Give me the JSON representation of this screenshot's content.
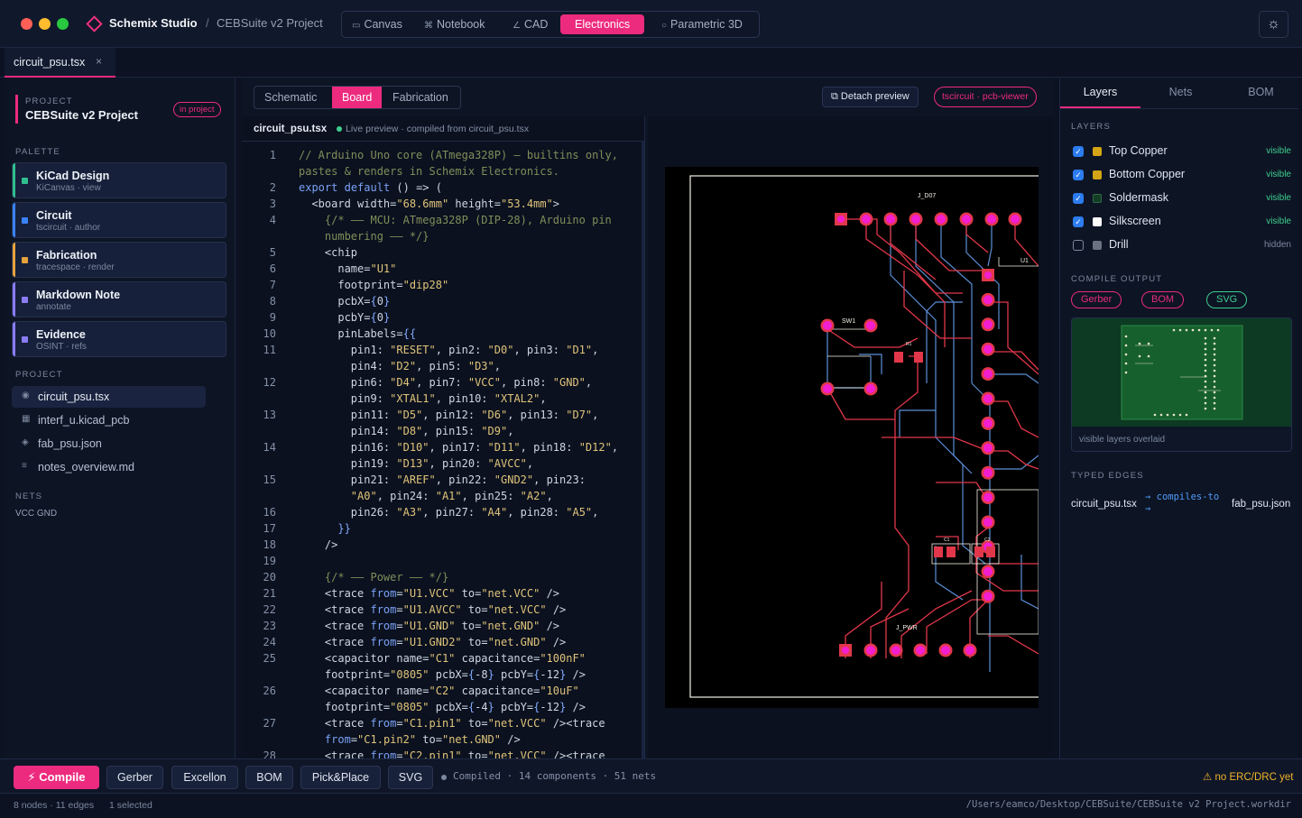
{
  "window": {
    "app_name": "Schemix Studio",
    "crumb_separator": "/",
    "project_crumb": "CEBSuite v2 Project",
    "modes": [
      {
        "icon": "▭",
        "label": "Canvas"
      },
      {
        "icon": "⌘",
        "label": "Notebook"
      },
      {
        "icon": "∠",
        "label": "CAD"
      },
      {
        "icon": "",
        "label": "Electronics",
        "active": true
      },
      {
        "icon": "○",
        "label": "Parametric 3D"
      }
    ],
    "theme_icon": "☼",
    "colors": {
      "accent": "#ec2b7e",
      "background": "#0c1222",
      "panel": "#0d1424",
      "ok": "#3ecf8e",
      "warn": "#f0b429"
    }
  },
  "tabbar": {
    "file_tab": "circuit_psu.tsx",
    "close_glyph": "×"
  },
  "sidebar": {
    "project_label": "PROJECT",
    "project_name": "CEBSuite v2 Project",
    "in_project_badge": "in project",
    "palette_label": "PALETTE",
    "palette": [
      {
        "title": "KiCad Design",
        "subtitle": "KiCanvas · view",
        "color": "#2fbf8f"
      },
      {
        "title": "Circuit",
        "subtitle": "tscircuit · author",
        "color": "#3b82f6"
      },
      {
        "title": "Fabrication",
        "subtitle": "tracespace · render",
        "color": "#e6a23c"
      },
      {
        "title": "Markdown Note",
        "subtitle": "annotate",
        "color": "#8b7cf6"
      },
      {
        "title": "Evidence",
        "subtitle": "OSINT · refs",
        "color": "#8b7cf6"
      }
    ],
    "files_label": "PROJECT",
    "files": [
      {
        "icon": "◉",
        "name": "circuit_psu.tsx",
        "selected": true
      },
      {
        "icon": "▦",
        "name": "interf_u.kicad_pcb"
      },
      {
        "icon": "◈",
        "name": "fab_psu.json"
      },
      {
        "icon": "≡",
        "name": "notes_overview.md"
      }
    ],
    "nets_label": "NETS",
    "nets_value": "VCC GND"
  },
  "center": {
    "subtabs": [
      "Schematic",
      "Board",
      "Fabrication"
    ],
    "active_subtab": "Board",
    "detach_label": "⧉ Detach preview",
    "viewer_badge": "tscircuit · pcb-viewer",
    "editor_file": "circuit_psu.tsx",
    "live_text": "Live preview · compiled from circuit_psu.tsx",
    "line_numbers": [
      "1",
      "2",
      "3",
      "4",
      "5",
      "6",
      "7",
      "8",
      "9",
      "10",
      "11",
      "12",
      "13",
      "14",
      "15",
      "16",
      "17",
      "18",
      "19",
      "20",
      "21",
      "22",
      "23",
      "24",
      "25",
      "26",
      "27",
      "28"
    ],
    "code_lines": [
      "// Arduino Uno core (ATmega328P) — builtins only,",
      "pastes & renders in Schemix Electronics.",
      "export default () => (",
      "  <board width=\"68.6mm\" height=\"53.4mm\">",
      "    {/* —— MCU: ATmega328P (DIP-28), Arduino pin",
      "    numbering —— */}",
      "    <chip",
      "      name=\"U1\"",
      "      footprint=\"dip28\"",
      "      pcbX={0}",
      "      pcbY={0}",
      "      pinLabels={{",
      "        pin1: \"RESET\", pin2: \"D0\", pin3: \"D1\",",
      "        pin4: \"D2\", pin5: \"D3\",",
      "        pin6: \"D4\", pin7: \"VCC\", pin8: \"GND\",",
      "        pin9: \"XTAL1\", pin10: \"XTAL2\",",
      "        pin11: \"D5\", pin12: \"D6\", pin13: \"D7\",",
      "        pin14: \"D8\", pin15: \"D9\",",
      "        pin16: \"D10\", pin17: \"D11\", pin18: \"D12\",",
      "        pin19: \"D13\", pin20: \"AVCC\",",
      "        pin21: \"AREF\", pin22: \"GND2\", pin23:",
      "        \"A0\", pin24: \"A1\", pin25: \"A2\",",
      "        pin26: \"A3\", pin27: \"A4\", pin28: \"A5\",",
      "      }}",
      "    />",
      "",
      "    {/* —— Power —— */}",
      "    <trace from=\"U1.VCC\" to=\"net.VCC\" />",
      "    <trace from=\"U1.AVCC\" to=\"net.VCC\" />",
      "    <trace from=\"U1.GND\" to=\"net.GND\" />",
      "    <trace from=\"U1.GND2\" to=\"net.GND\" />",
      "    <capacitor name=\"C1\" capacitance=\"100nF\"",
      "    footprint=\"0805\" pcbX={-8} pcbY={-12} />",
      "    <capacitor name=\"C2\" capacitance=\"10uF\"",
      "    footprint=\"0805\" pcbX={-4} pcbY={-12} />",
      "    <trace from=\"C1.pin1\" to=\"net.VCC\" /><trace",
      "    from=\"C1.pin2\" to=\"net.GND\" />",
      "    <trace from=\"C2.pin1\" to=\"net.VCC\" /><trace"
    ],
    "pcb_labels": {
      "top_header": "J_D07",
      "chip": "U1",
      "switch": "SW1",
      "resistor": "R1",
      "cap1": "C1",
      "cap2": "C2",
      "power": "J_PWR"
    }
  },
  "right": {
    "tabs": [
      "Layers",
      "Nets",
      "BOM"
    ],
    "active_tab": "Layers",
    "layers_title": "LAYERS",
    "layers": [
      {
        "name": "Top Copper",
        "state": "visible",
        "checked": true,
        "color": "#d4a514"
      },
      {
        "name": "Bottom Copper",
        "state": "visible",
        "checked": true,
        "color": "#d4a514"
      },
      {
        "name": "Soldermask",
        "state": "visible",
        "checked": true,
        "color": "#153d26"
      },
      {
        "name": "Silkscreen",
        "state": "visible",
        "checked": true,
        "color": "#ffffff"
      },
      {
        "name": "Drill",
        "state": "hidden",
        "checked": false,
        "color": "#6b7280"
      }
    ],
    "compile_title": "COMPILE OUTPUT",
    "outputs": [
      {
        "label": "Gerber",
        "color": "#ec2b7e"
      },
      {
        "label": "BOM",
        "color": "#ec2b7e"
      },
      {
        "label": "SVG",
        "color": "#3ecf8e"
      }
    ],
    "thumb_caption": "visible layers overlaid",
    "edges_title": "TYPED EDGES",
    "edge": {
      "from": "circuit_psu.tsx",
      "relation": "→ compiles-to →",
      "to": "fab_psu.json"
    }
  },
  "toolbar": {
    "compile_label": "⚡ Compile",
    "buttons": [
      "Gerber",
      "Excellon",
      "BOM",
      "Pick&Place",
      "SVG"
    ],
    "status": "Compiled · 14 components · 51 nets",
    "erc": "⚠ no ERC/DRC yet"
  },
  "statusbar": {
    "nodes": "8 nodes · 11 edges",
    "selected": "1 selected",
    "path": "/Users/eamco/Desktop/CEBSuite/CEBSuite v2 Project.workdir"
  }
}
